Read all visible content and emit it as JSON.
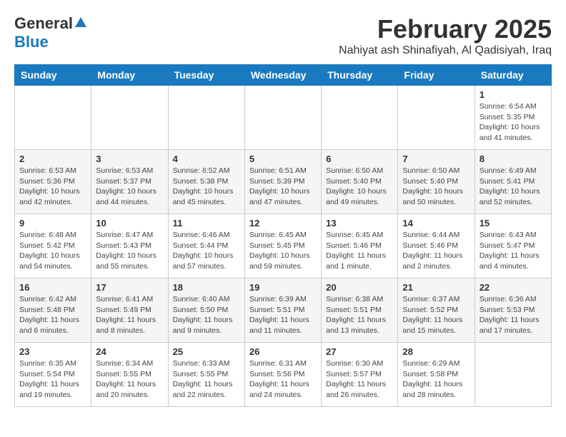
{
  "logo": {
    "general": "General",
    "blue": "Blue"
  },
  "header": {
    "month": "February 2025",
    "location": "Nahiyat ash Shinafiyah, Al Qadisiyah, Iraq"
  },
  "weekdays": [
    "Sunday",
    "Monday",
    "Tuesday",
    "Wednesday",
    "Thursday",
    "Friday",
    "Saturday"
  ],
  "weeks": [
    [
      {
        "day": "",
        "text": ""
      },
      {
        "day": "",
        "text": ""
      },
      {
        "day": "",
        "text": ""
      },
      {
        "day": "",
        "text": ""
      },
      {
        "day": "",
        "text": ""
      },
      {
        "day": "",
        "text": ""
      },
      {
        "day": "1",
        "text": "Sunrise: 6:54 AM\nSunset: 5:35 PM\nDaylight: 10 hours and 41 minutes."
      }
    ],
    [
      {
        "day": "2",
        "text": "Sunrise: 6:53 AM\nSunset: 5:36 PM\nDaylight: 10 hours and 42 minutes."
      },
      {
        "day": "3",
        "text": "Sunrise: 6:53 AM\nSunset: 5:37 PM\nDaylight: 10 hours and 44 minutes."
      },
      {
        "day": "4",
        "text": "Sunrise: 6:52 AM\nSunset: 5:38 PM\nDaylight: 10 hours and 45 minutes."
      },
      {
        "day": "5",
        "text": "Sunrise: 6:51 AM\nSunset: 5:39 PM\nDaylight: 10 hours and 47 minutes."
      },
      {
        "day": "6",
        "text": "Sunrise: 6:50 AM\nSunset: 5:40 PM\nDaylight: 10 hours and 49 minutes."
      },
      {
        "day": "7",
        "text": "Sunrise: 6:50 AM\nSunset: 5:40 PM\nDaylight: 10 hours and 50 minutes."
      },
      {
        "day": "8",
        "text": "Sunrise: 6:49 AM\nSunset: 5:41 PM\nDaylight: 10 hours and 52 minutes."
      }
    ],
    [
      {
        "day": "9",
        "text": "Sunrise: 6:48 AM\nSunset: 5:42 PM\nDaylight: 10 hours and 54 minutes."
      },
      {
        "day": "10",
        "text": "Sunrise: 6:47 AM\nSunset: 5:43 PM\nDaylight: 10 hours and 55 minutes."
      },
      {
        "day": "11",
        "text": "Sunrise: 6:46 AM\nSunset: 5:44 PM\nDaylight: 10 hours and 57 minutes."
      },
      {
        "day": "12",
        "text": "Sunrise: 6:45 AM\nSunset: 5:45 PM\nDaylight: 10 hours and 59 minutes."
      },
      {
        "day": "13",
        "text": "Sunrise: 6:45 AM\nSunset: 5:46 PM\nDaylight: 11 hours and 1 minute."
      },
      {
        "day": "14",
        "text": "Sunrise: 6:44 AM\nSunset: 5:46 PM\nDaylight: 11 hours and 2 minutes."
      },
      {
        "day": "15",
        "text": "Sunrise: 6:43 AM\nSunset: 5:47 PM\nDaylight: 11 hours and 4 minutes."
      }
    ],
    [
      {
        "day": "16",
        "text": "Sunrise: 6:42 AM\nSunset: 5:48 PM\nDaylight: 11 hours and 6 minutes."
      },
      {
        "day": "17",
        "text": "Sunrise: 6:41 AM\nSunset: 5:49 PM\nDaylight: 11 hours and 8 minutes."
      },
      {
        "day": "18",
        "text": "Sunrise: 6:40 AM\nSunset: 5:50 PM\nDaylight: 11 hours and 9 minutes."
      },
      {
        "day": "19",
        "text": "Sunrise: 6:39 AM\nSunset: 5:51 PM\nDaylight: 11 hours and 11 minutes."
      },
      {
        "day": "20",
        "text": "Sunrise: 6:38 AM\nSunset: 5:51 PM\nDaylight: 11 hours and 13 minutes."
      },
      {
        "day": "21",
        "text": "Sunrise: 6:37 AM\nSunset: 5:52 PM\nDaylight: 11 hours and 15 minutes."
      },
      {
        "day": "22",
        "text": "Sunrise: 6:36 AM\nSunset: 5:53 PM\nDaylight: 11 hours and 17 minutes."
      }
    ],
    [
      {
        "day": "23",
        "text": "Sunrise: 6:35 AM\nSunset: 5:54 PM\nDaylight: 11 hours and 19 minutes."
      },
      {
        "day": "24",
        "text": "Sunrise: 6:34 AM\nSunset: 5:55 PM\nDaylight: 11 hours and 20 minutes."
      },
      {
        "day": "25",
        "text": "Sunrise: 6:33 AM\nSunset: 5:55 PM\nDaylight: 11 hours and 22 minutes."
      },
      {
        "day": "26",
        "text": "Sunrise: 6:31 AM\nSunset: 5:56 PM\nDaylight: 11 hours and 24 minutes."
      },
      {
        "day": "27",
        "text": "Sunrise: 6:30 AM\nSunset: 5:57 PM\nDaylight: 11 hours and 26 minutes."
      },
      {
        "day": "28",
        "text": "Sunrise: 6:29 AM\nSunset: 5:58 PM\nDaylight: 11 hours and 28 minutes."
      },
      {
        "day": "",
        "text": ""
      }
    ]
  ]
}
